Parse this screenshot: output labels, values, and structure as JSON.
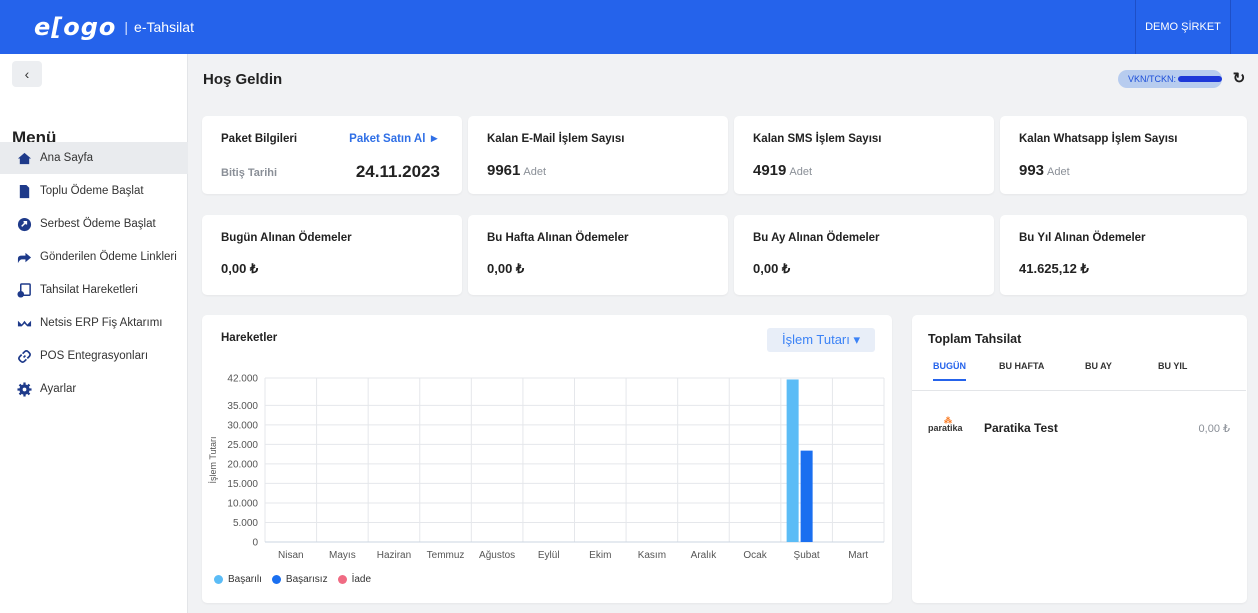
{
  "app": {
    "logo_text": "e[ogo",
    "separator": "|",
    "app_name": "e-Tahsilat",
    "company": "DEMO ŞİRKET"
  },
  "sidebar": {
    "back_icon": "‹",
    "menu_title": "Menü",
    "items": [
      {
        "label": "Ana Sayfa",
        "icon": "home-icon",
        "active": true
      },
      {
        "label": "Toplu Ödeme Başlat",
        "icon": "file-icon",
        "active": false
      },
      {
        "label": "Serbest Ödeme Başlat",
        "icon": "circle-arrow-icon",
        "active": false
      },
      {
        "label": "Gönderilen Ödeme Linkleri",
        "icon": "send-icon",
        "active": false
      },
      {
        "label": "Tahsilat Hareketleri",
        "icon": "transactions-icon",
        "active": false
      },
      {
        "label": "Netsis ERP Fiş Aktarımı",
        "icon": "transfer-icon",
        "active": false
      },
      {
        "label": "POS Entegrasyonları",
        "icon": "link-icon",
        "active": false
      },
      {
        "label": "Ayarlar",
        "icon": "gear-icon",
        "active": false
      }
    ]
  },
  "header": {
    "title": "Hoş Geldin",
    "vkn_label": "VKN/TCKN:",
    "refresh_icon": "↻"
  },
  "package": {
    "title": "Paket Bilgileri",
    "buy_label": "Paket Satın Al ►",
    "end_label": "Bitiş Tarihi",
    "end_date": "24.11.2023"
  },
  "quotas": [
    {
      "title": "Kalan E-Mail İşlem Sayısı",
      "value": "9961",
      "unit": "Adet"
    },
    {
      "title": "Kalan SMS İşlem Sayısı",
      "value": "4919",
      "unit": "Adet"
    },
    {
      "title": "Kalan Whatsapp İşlem Sayısı",
      "value": "993",
      "unit": "Adet"
    }
  ],
  "payments": [
    {
      "title": "Bugün Alınan Ödemeler",
      "value": "0,00 ₺"
    },
    {
      "title": "Bu Hafta Alınan Ödemeler",
      "value": "0,00 ₺"
    },
    {
      "title": "Bu Ay Alınan Ödemeler",
      "value": "0,00 ₺"
    },
    {
      "title": "Bu Yıl Alınan Ödemeler",
      "value": "41.625,12 ₺"
    }
  ],
  "movements": {
    "title": "Hareketler",
    "select_label": "İşlem Tutarı ▾"
  },
  "chart_data": {
    "type": "bar",
    "categories": [
      "Nisan",
      "Mayıs",
      "Haziran",
      "Temmuz",
      "Ağustos",
      "Eylül",
      "Ekim",
      "Kasım",
      "Aralık",
      "Ocak",
      "Şubat",
      "Mart"
    ],
    "series": [
      {
        "name": "Başarılı",
        "color": "#5bbcf6",
        "values": [
          0,
          0,
          0,
          0,
          0,
          0,
          0,
          0,
          0,
          0,
          41625,
          0
        ]
      },
      {
        "name": "Başarısız",
        "color": "#1a6ff0",
        "values": [
          0,
          0,
          0,
          0,
          0,
          0,
          0,
          0,
          0,
          0,
          23400,
          0
        ]
      },
      {
        "name": "İade",
        "color": "#f06b83",
        "values": [
          0,
          0,
          0,
          0,
          0,
          0,
          0,
          0,
          0,
          0,
          0,
          0
        ]
      }
    ],
    "ylabel": "İşlem Tutarı",
    "ylim": [
      0,
      42000
    ],
    "yticks": [
      0,
      5000,
      10000,
      15000,
      20000,
      25000,
      30000,
      35000,
      42000
    ],
    "ytick_labels": [
      "0",
      "5.000",
      "10.000",
      "15.000",
      "20.000",
      "25.000",
      "30.000",
      "35.000",
      "42.000"
    ],
    "grid": true,
    "legend": "bottom-left"
  },
  "totals": {
    "title": "Toplam Tahsilat",
    "tabs": [
      "BUGÜN",
      "BU HAFTA",
      "BU AY",
      "BU YIL"
    ],
    "active_tab": 0,
    "provider_logo": "paratika",
    "provider_name": "Paratika Test",
    "provider_amount": "0,00 ₺"
  }
}
